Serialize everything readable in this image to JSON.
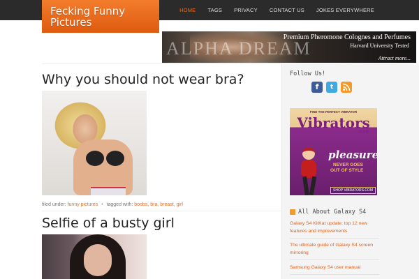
{
  "site": {
    "title_line1": "Fecking Funny",
    "title_line2": "Pictures"
  },
  "nav": {
    "items": [
      "HOME",
      "TAGS",
      "PRIVACY",
      "CONTACT US",
      "JOKES EVERYWHERE"
    ],
    "active": "HOME",
    "accent_color": "#f06a1a"
  },
  "banner": {
    "wordmark": "ALPHA DREAM",
    "headline": "Premium Pheromone Colognes and Perfumes",
    "subline": "Harvard University Tested",
    "cta": "Attract more..."
  },
  "posts": [
    {
      "title": "Why you should not wear bra?",
      "meta": {
        "filed_under_label": "filed under:",
        "category": "funny pictures",
        "tagged_with_label": "tagged with:",
        "tags": [
          "boobs",
          "bra",
          "breast",
          "girl"
        ]
      }
    },
    {
      "title": "Selfie of a busty girl"
    }
  ],
  "sidebar": {
    "follow_title": "Follow Us!",
    "social_icons": [
      "facebook-icon",
      "twitter-icon",
      "rss-icon"
    ],
    "ad": {
      "top_line": "FIND THE PERFECT VIBRATOR",
      "brand": "Vibrators",
      "dotcom": ".com",
      "headline": "pleasure",
      "tag_line1": "NEVER GOES",
      "tag_line2": "OUT OF STYLE",
      "shop": "SHOP VIBRATORS.COM"
    },
    "galaxy": {
      "title": "All About Galaxy S4",
      "links": [
        "Galaxy S4 KitKat update: top 12 new features and improvements",
        "The ultimate guide of Galaxy S4 screen mirroring",
        "Samsung Galaxy S4 user manual"
      ]
    }
  }
}
